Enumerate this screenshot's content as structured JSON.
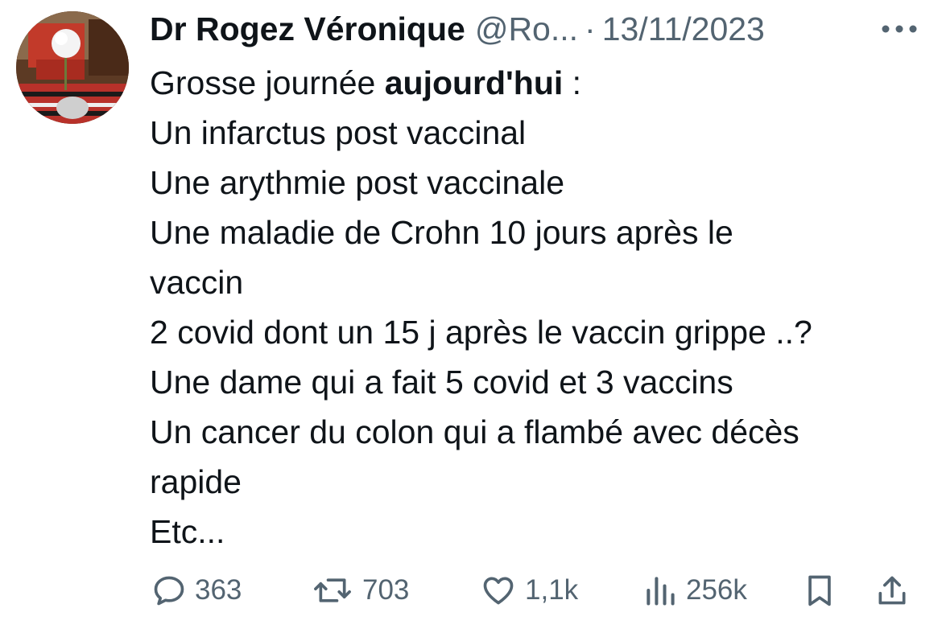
{
  "tweet": {
    "author_name": "Dr Rogez Véronique",
    "handle": "@Ro...",
    "separator": "·",
    "date": "13/11/2023",
    "more_icon": "more-dots-icon",
    "text_lines": [
      {
        "pre": "Grosse journée ",
        "bold": "aujourd'hui",
        "post": " :"
      },
      "Un infarctus post vaccinal",
      "Une arythmie post vaccinale",
      "Une maladie de Crohn 10 jours après le",
      "vaccin",
      "2 covid dont un 15 j après le vaccin grippe ..?",
      "Une dame qui a fait 5 covid et 3 vaccins",
      "Un cancer du colon qui a flambé avec décès",
      "rapide",
      "Etc..."
    ],
    "actions": {
      "reply": {
        "icon": "reply-icon",
        "count": "363"
      },
      "retweet": {
        "icon": "retweet-icon",
        "count": "703"
      },
      "like": {
        "icon": "heart-icon",
        "count": "1,1k"
      },
      "views": {
        "icon": "views-icon",
        "count": "256k"
      },
      "bookmark": {
        "icon": "bookmark-icon"
      },
      "share": {
        "icon": "share-icon"
      }
    },
    "colors": {
      "text": "#0f1419",
      "secondary": "#536471",
      "background": "#ffffff"
    }
  }
}
